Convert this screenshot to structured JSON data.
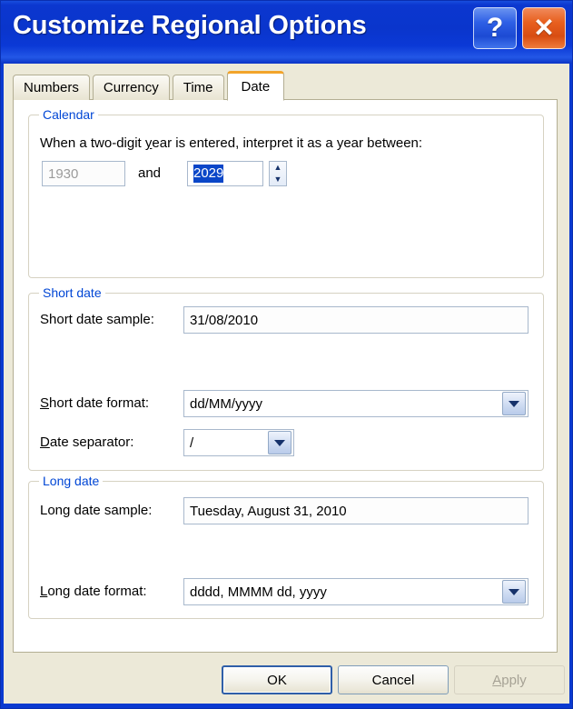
{
  "window": {
    "title": "Customize Regional Options",
    "help_button": "?",
    "close_button": "✕"
  },
  "tabs": [
    {
      "label": "Numbers",
      "active": false
    },
    {
      "label": "Currency",
      "active": false
    },
    {
      "label": "Time",
      "active": false
    },
    {
      "label": "Date",
      "active": true
    }
  ],
  "calendar": {
    "legend": "Calendar",
    "instruction_before": "When a two-digit ",
    "instruction_accel": "y",
    "instruction_after": "ear is entered, interpret it as a year between:",
    "instruction_full": "When a two-digit year is entered, interpret it as a year between:",
    "year_low": "1930",
    "and_label": "and",
    "year_high": "2029",
    "spinner_up": "▲",
    "spinner_down": "▼"
  },
  "short_date": {
    "legend": "Short date",
    "sample_label": "Short date sample:",
    "sample_value": "31/08/2010",
    "format_label_accel": "S",
    "format_label_rest": "hort date format:",
    "format_label_full": "Short date format:",
    "format_value": "dd/MM/yyyy",
    "separator_label_accel": "D",
    "separator_label_rest": "ate separator:",
    "separator_label_full": "Date separator:",
    "separator_value": "/"
  },
  "long_date": {
    "legend": "Long date",
    "sample_label": "Long date sample:",
    "sample_value": "Tuesday, August 31, 2010",
    "format_label_accel": "L",
    "format_label_rest": "ong date format:",
    "format_label_full": "Long date format:",
    "format_value": "dddd, MMMM dd, yyyy"
  },
  "footer": {
    "ok": "OK",
    "cancel": "Cancel",
    "apply_accel": "A",
    "apply_rest": "pply",
    "apply_full": "Apply"
  },
  "colors": {
    "titlebar_blue": "#0a35cc",
    "accent_orange": "#f2a42b",
    "group_legend_blue": "#0046d5",
    "selection_blue": "#0a46c8",
    "dialog_face": "#ece9d8"
  }
}
